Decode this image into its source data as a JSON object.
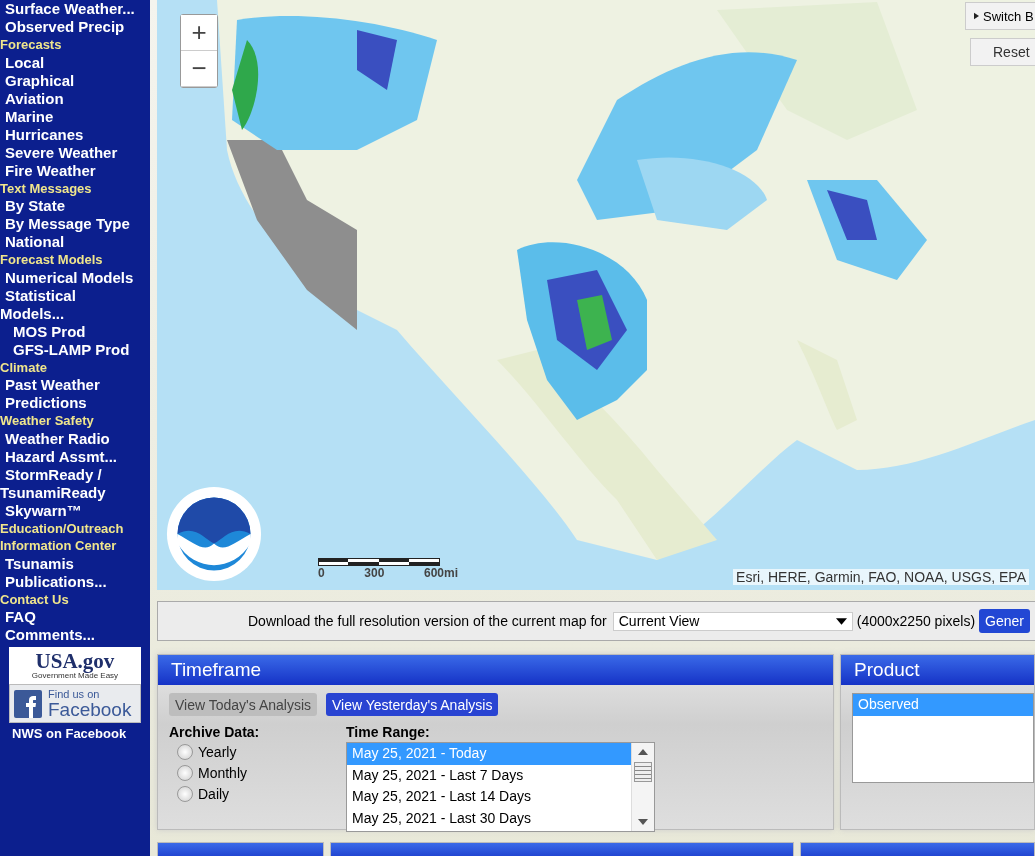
{
  "sidebar": {
    "items": [
      {
        "kind": "link",
        "label": "Surface Weather..."
      },
      {
        "kind": "link",
        "label": "Observed Precip"
      },
      {
        "kind": "heading",
        "label": "Forecasts"
      },
      {
        "kind": "link",
        "label": "Local"
      },
      {
        "kind": "link",
        "label": "Graphical"
      },
      {
        "kind": "link",
        "label": "Aviation"
      },
      {
        "kind": "link",
        "label": "Marine"
      },
      {
        "kind": "link",
        "label": "Hurricanes"
      },
      {
        "kind": "link",
        "label": "Severe Weather"
      },
      {
        "kind": "link",
        "label": "Fire Weather"
      },
      {
        "kind": "heading",
        "label": "Text Messages"
      },
      {
        "kind": "link",
        "label": "By State"
      },
      {
        "kind": "link",
        "label": "By Message Type"
      },
      {
        "kind": "link",
        "label": "National"
      },
      {
        "kind": "heading",
        "label": "Forecast Models"
      },
      {
        "kind": "link",
        "label": "Numerical Models"
      },
      {
        "kind": "link",
        "label": "Statistical Models...",
        "children": [
          {
            "kind": "link",
            "label": "MOS Prod"
          },
          {
            "kind": "link",
            "label": "GFS-LAMP Prod"
          }
        ]
      },
      {
        "kind": "heading",
        "label": "Climate"
      },
      {
        "kind": "link",
        "label": "Past Weather"
      },
      {
        "kind": "link",
        "label": "Predictions"
      },
      {
        "kind": "heading",
        "label": "Weather Safety"
      },
      {
        "kind": "link",
        "label": "Weather Radio"
      },
      {
        "kind": "link",
        "label": "Hazard Assmt..."
      },
      {
        "kind": "link",
        "label": "StormReady / TsunamiReady"
      },
      {
        "kind": "link",
        "label": "Skywarn™"
      },
      {
        "kind": "heading",
        "label": "Education/Outreach"
      },
      {
        "kind": "heading",
        "label": "Information Center"
      },
      {
        "kind": "link",
        "label": "Tsunamis"
      },
      {
        "kind": "link",
        "label": "Publications..."
      },
      {
        "kind": "heading",
        "label": "Contact Us"
      },
      {
        "kind": "link",
        "label": "FAQ"
      },
      {
        "kind": "link",
        "label": "Comments..."
      }
    ],
    "usa_gov": {
      "title": "USA.gov",
      "tagline": "Government Made Easy"
    },
    "facebook": {
      "line1": "Find us on",
      "line2": "Facebook"
    },
    "facebook_caption": "NWS on Facebook"
  },
  "map": {
    "zoom_in": "+",
    "zoom_out": "−",
    "switch_button": "Switch B",
    "reset_button": "Reset",
    "scale_labels": [
      "0",
      "300",
      "600mi"
    ],
    "attribution": "Esri, HERE, Garmin, FAO, NOAA, USGS, EPA"
  },
  "download": {
    "text": "Download the full resolution version of the current map for",
    "select_value": "Current View",
    "size": "(4000x2250 pixels)",
    "button": "Gener"
  },
  "timeframe": {
    "title": "Timeframe",
    "buttons": [
      {
        "label": "View Today's Analysis",
        "selected": true
      },
      {
        "label": "View Yesterday's Analysis",
        "selected": false
      }
    ],
    "archive_label": "Archive Data:",
    "radios": [
      {
        "label": "Yearly",
        "checked": false
      },
      {
        "label": "Monthly",
        "checked": false
      },
      {
        "label": "Daily",
        "checked": false
      }
    ],
    "time_range_label": "Time Range:",
    "options": [
      {
        "label": "May 25, 2021 - Today",
        "selected": true
      },
      {
        "label": "May 25, 2021 - Last 7 Days",
        "selected": false
      },
      {
        "label": "May 25, 2021 - Last 14 Days",
        "selected": false
      },
      {
        "label": "May 25, 2021 - Last 30 Days",
        "selected": false
      }
    ]
  },
  "product": {
    "title": "Product",
    "options": [
      {
        "label": "Observed",
        "selected": true
      }
    ]
  }
}
